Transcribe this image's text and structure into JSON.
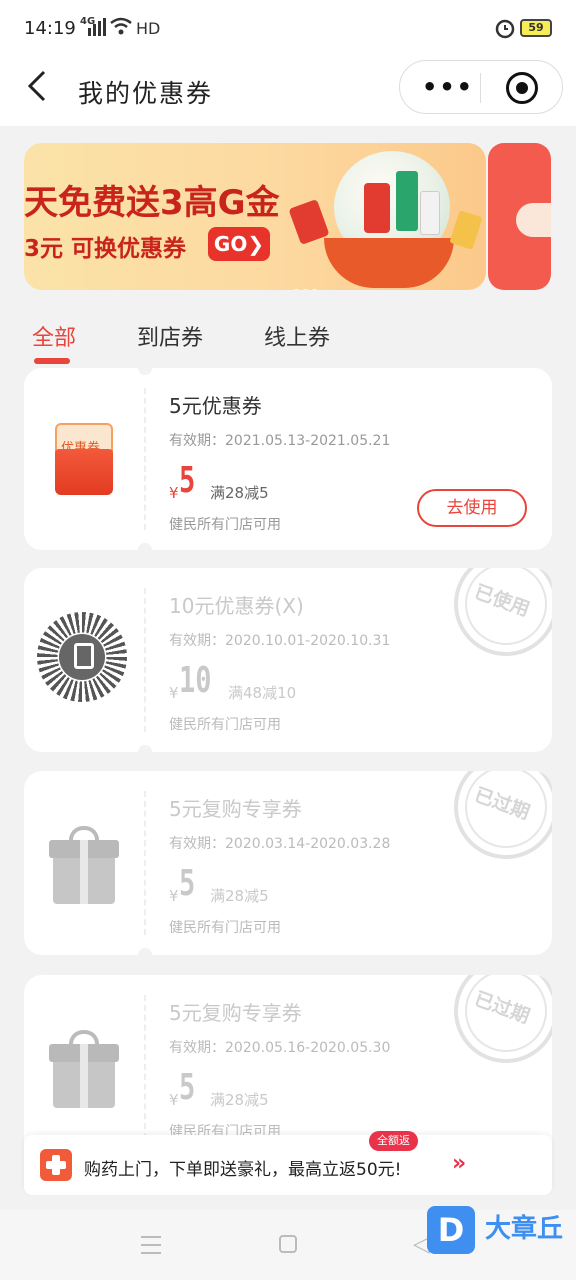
{
  "status_bar": {
    "time": "14:19",
    "network": "4G",
    "hd": "HD",
    "battery": "59"
  },
  "nav": {
    "back_icon": "chevron-left-icon",
    "title": "我的优惠券",
    "more_label": "•••"
  },
  "banner": {
    "line1": "天免费送3高G金",
    "line2": "3元 可换优惠券",
    "go_label": "GO❯"
  },
  "tabs": [
    {
      "label": "全部",
      "active": true
    },
    {
      "label": "到店券",
      "active": false
    },
    {
      "label": "线上券",
      "active": false
    }
  ],
  "coupons": [
    {
      "name": "5元优惠券",
      "period": "有效期：2021.05.13-2021.05.21",
      "yen": "¥",
      "amount": "5",
      "condition": "满28减5",
      "scope": "健民所有门店可用",
      "action": "去使用",
      "icon_label": "优惠券",
      "status": "available"
    },
    {
      "name": "10元优惠券(X)",
      "period": "有效期：2020.10.01-2020.10.31",
      "yen": "¥",
      "amount": "10",
      "condition": "满48减10",
      "scope": "健民所有门店可用",
      "stamp": "已使用",
      "status": "used"
    },
    {
      "name": "5元复购专享券",
      "period": "有效期：2020.03.14-2020.03.28",
      "yen": "¥",
      "amount": "5",
      "condition": "满28减5",
      "scope": "健民所有门店可用",
      "stamp": "已过期",
      "status": "expired"
    },
    {
      "name": "5元复购专享券",
      "period": "有效期：2020.05.16-2020.05.30",
      "yen": "¥",
      "amount": "5",
      "condition": "满28减5",
      "scope": "健民所有门店可用",
      "stamp": "已过期",
      "status": "expired"
    }
  ],
  "promo": {
    "text": "购药上门，下单即送豪礼，最高立返50元!",
    "badge": "全额返",
    "arrow": "»"
  },
  "watermark": {
    "logo": "D",
    "text": "大章丘"
  },
  "colors": {
    "accent": "#e8453c",
    "background": "#f2f2f2"
  }
}
